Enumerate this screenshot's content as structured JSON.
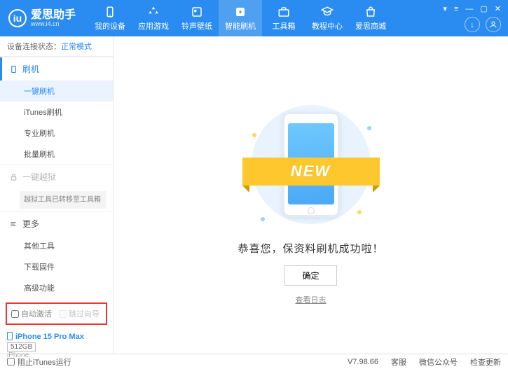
{
  "header": {
    "app_name": "爱思助手",
    "app_url": "www.i4.cn",
    "tabs": [
      {
        "label": "我的设备"
      },
      {
        "label": "应用游戏"
      },
      {
        "label": "铃声壁纸"
      },
      {
        "label": "智能刷机"
      },
      {
        "label": "工具箱"
      },
      {
        "label": "教程中心"
      },
      {
        "label": "爱思商城"
      }
    ],
    "active_tab_index": 3
  },
  "sidebar": {
    "status_label": "设备连接状态：",
    "status_value": "正常模式",
    "sections": {
      "flash": {
        "title": "刷机",
        "items": [
          "一键刷机",
          "iTunes刷机",
          "专业刷机",
          "批量刷机"
        ],
        "active_index": 0
      },
      "jailbreak": {
        "title": "一键越狱",
        "note": "越狱工具已转移至工具箱"
      },
      "more": {
        "title": "更多",
        "items": [
          "其他工具",
          "下载固件",
          "高级功能"
        ]
      }
    },
    "checkboxes": {
      "auto_activate": "自动激活",
      "skip_guide": "跳过向导"
    },
    "device": {
      "name": "iPhone 15 Pro Max",
      "storage": "512GB",
      "type": "iPhone"
    }
  },
  "main": {
    "ribbon_text": "NEW",
    "success_message": "恭喜您，保资料刷机成功啦！",
    "confirm_button": "确定",
    "view_log": "查看日志"
  },
  "footer": {
    "block_itunes": "阻止iTunes运行",
    "version": "V7.98.66",
    "links": [
      "客服",
      "微信公众号",
      "检查更新"
    ]
  }
}
